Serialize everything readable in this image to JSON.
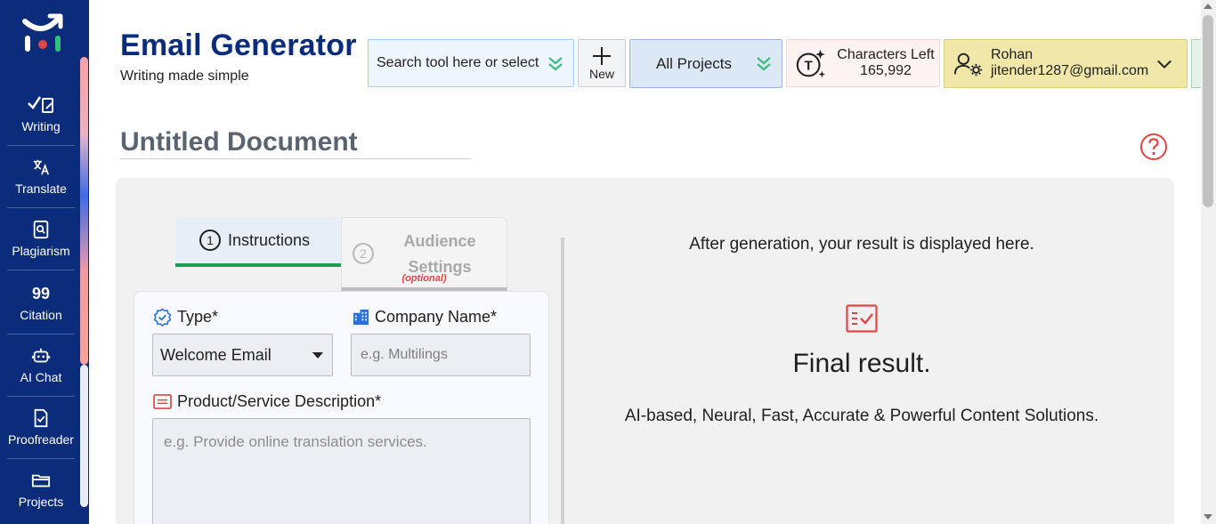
{
  "sidebar": {
    "items": [
      {
        "label": "Writing",
        "icon": "writing-icon"
      },
      {
        "label": "Translate",
        "icon": "translate-icon"
      },
      {
        "label": "Plagiarism",
        "icon": "plagiarism-icon"
      },
      {
        "label": "Citation",
        "icon": "citation-icon"
      },
      {
        "label": "AI Chat",
        "icon": "robot-icon"
      },
      {
        "label": "Proofreader",
        "icon": "proofreader-icon"
      },
      {
        "label": "Projects",
        "icon": "folder-icon"
      }
    ],
    "active_index": 0,
    "citation_glyph": "99"
  },
  "header": {
    "title": "Email Generator",
    "subtitle": "Writing made simple",
    "search_label": "Search tool here or select",
    "new_label": "New",
    "projects_label": "All Projects",
    "chars_label": "Characters Left",
    "chars_value": "165,992",
    "chars_icon_letter": "T",
    "user_name": "Rohan",
    "user_email": "jitender1287@gmail.com"
  },
  "document": {
    "title": "Untitled Document"
  },
  "tabs": [
    {
      "number": "1",
      "label": "Instructions",
      "active": true
    },
    {
      "number": "2",
      "label": "Audience Settings",
      "badge": "(optional)",
      "active": false
    }
  ],
  "form": {
    "type_label": "Type*",
    "type_value": "Welcome Email",
    "company_label": "Company Name*",
    "company_placeholder": "e.g. Multilings",
    "product_label": "Product/Service Description*",
    "product_placeholder": "e.g. Provide online translation services."
  },
  "result": {
    "top_text": "After generation, your result is displayed here.",
    "title": "Final result.",
    "description": "AI-based, Neural, Fast, Accurate & Powerful Content Solutions."
  },
  "colors": {
    "sidebar_bg": "#0b2c7a",
    "accent_green": "#1f9d57",
    "accent_red": "#e04646",
    "title_blue": "#0b2c7a"
  }
}
